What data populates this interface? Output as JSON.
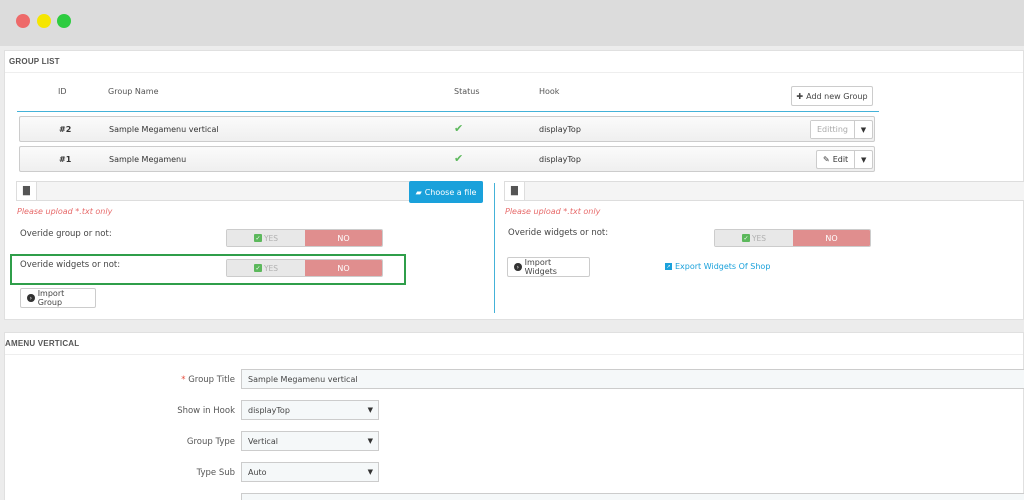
{
  "window": {
    "controls": [
      "close",
      "minimize",
      "maximize"
    ]
  },
  "group_list": {
    "heading": "GROUP LIST",
    "columns": {
      "id": "ID",
      "name": "Group Name",
      "status": "Status",
      "hook": "Hook"
    },
    "add_button": "Add new Group",
    "rows": [
      {
        "id": "#2",
        "name": "Sample Megamenu vertical",
        "status_icon": "check-icon",
        "hook": "displayTop",
        "action": "Editting"
      },
      {
        "id": "#1",
        "name": "Sample Megamenu",
        "status_icon": "check-icon",
        "hook": "displayTop",
        "action": "Edit"
      }
    ]
  },
  "import_left": {
    "choose_file": "Choose a file",
    "hint": "Please upload *.txt only",
    "override_group_label": "Overide group or not:",
    "override_widgets_label": "Overide widgets or not:",
    "yes": "YES",
    "no": "NO",
    "import_button": "Import Group"
  },
  "import_right": {
    "hint": "Please upload *.txt only",
    "override_widgets_label": "Overide widgets or not:",
    "yes": "YES",
    "no": "NO",
    "import_button": "Import Widgets",
    "export_link": "Export Widgets Of Shop"
  },
  "form": {
    "heading": "AMENU VERTICAL",
    "group_title_label": "Group Title",
    "group_title_value": "Sample Megamenu vertical",
    "show_in_hook_label": "Show in Hook",
    "show_in_hook_value": "displayTop",
    "group_type_label": "Group Type",
    "group_type_value": "Vertical",
    "type_sub_label": "Type Sub",
    "type_sub_value": "Auto",
    "required_mark": "*"
  },
  "colors": {
    "accent": "#1aa1db",
    "no": "#e08e8e",
    "highlight": "#2f9e4a",
    "status": "#5cb85c"
  }
}
